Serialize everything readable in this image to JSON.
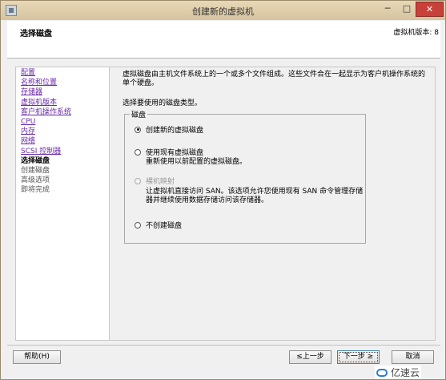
{
  "window": {
    "title": "创建新的虚拟机",
    "min_glyph": "─",
    "max_glyph": "□",
    "close_glyph": "✕"
  },
  "header": {
    "title": "选择磁盘",
    "vm_version": "虚拟机版本: 8"
  },
  "nav": {
    "items": [
      {
        "label": "配置",
        "state": "link"
      },
      {
        "label": "名称和位置",
        "state": "link"
      },
      {
        "label": "存储器",
        "state": "link"
      },
      {
        "label": "虚拟机版本",
        "state": "link"
      },
      {
        "label": "客户机操作系统",
        "state": "link"
      },
      {
        "label": "CPU",
        "state": "link"
      },
      {
        "label": "内存",
        "state": "link"
      },
      {
        "label": "网络",
        "state": "link"
      },
      {
        "label": "SCSI 控制器",
        "state": "link"
      },
      {
        "label": "选择磁盘",
        "state": "current"
      },
      {
        "label": "创建磁盘",
        "state": "pending"
      },
      {
        "label": "高级选项",
        "state": "pending"
      },
      {
        "label": "即将完成",
        "state": "pending"
      }
    ]
  },
  "main": {
    "description": "虚拟磁盘由主机文件系统上的一个或多个文件组成。这些文件合在一起显示为客户机操作系统的单个硬盘。",
    "prompt": "选择要使用的磁盘类型。",
    "group_label": "磁盘",
    "options": {
      "create_new": {
        "label": "创建新的虚拟磁盘",
        "selected": true
      },
      "use_existing": {
        "label": "使用现有虚拟磁盘",
        "description": "重新使用以前配置的虚拟磁盘。"
      },
      "raw_mapping": {
        "label": "裸机映射",
        "disabled": true,
        "description_line1": "让虚拟机直接访问 SAN。该选项允许您使用现有 SAN 命令管理存储",
        "description_line2": "器并继续使用数据存储访问该存储器。"
      },
      "no_disk": {
        "label": "不创建磁盘"
      }
    }
  },
  "footer": {
    "help_label": "帮助(H)",
    "back_label": "≤上一步",
    "next_label": "下一步 ≥",
    "cancel_label": "取消"
  },
  "watermark": {
    "text": "亿速云"
  }
}
